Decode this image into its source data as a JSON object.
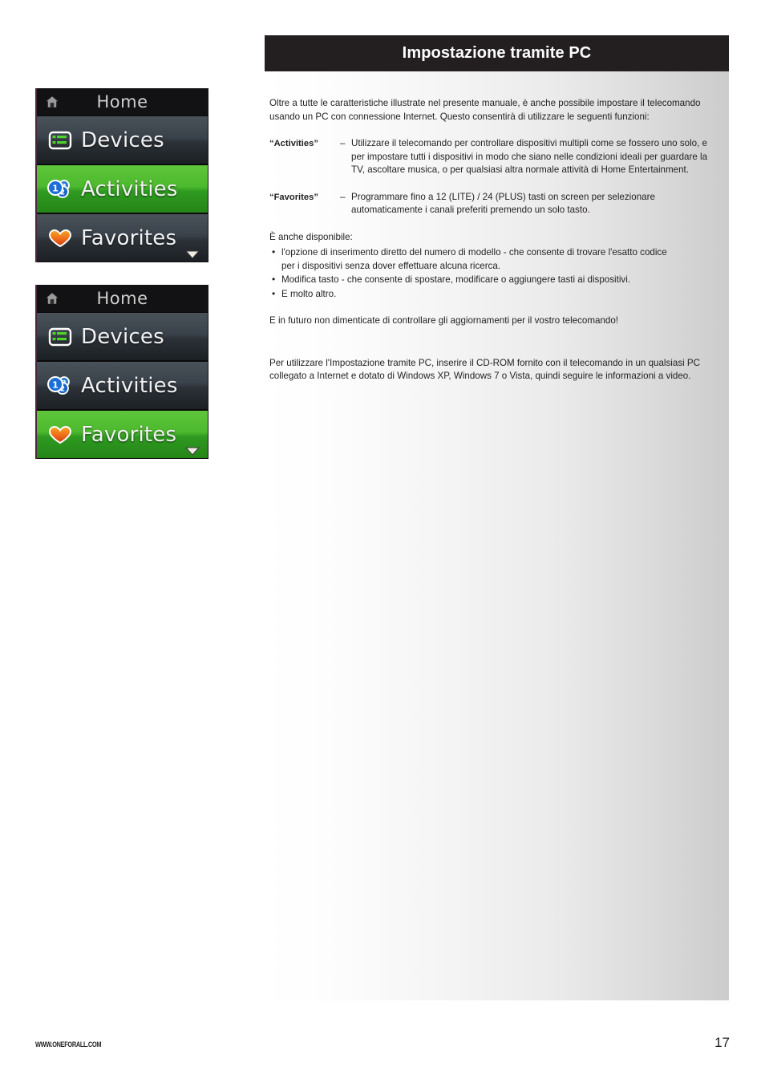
{
  "header": {
    "title": "Impostazione tramite PC"
  },
  "lcd_screens": [
    {
      "titlebar": {
        "icon": "home-icon",
        "label": "Home"
      },
      "rows": [
        {
          "icon": "devices-icon",
          "label": "Devices",
          "highlighted": false
        },
        {
          "icon": "activities-icon",
          "label": "Activities",
          "highlighted": true
        },
        {
          "icon": "favorites-heart-icon",
          "label": "Favorites",
          "highlighted": false
        }
      ],
      "scroll_arrow": "chevron-down-icon"
    },
    {
      "titlebar": {
        "icon": "home-icon",
        "label": "Home"
      },
      "rows": [
        {
          "icon": "devices-icon",
          "label": "Devices",
          "highlighted": false
        },
        {
          "icon": "activities-icon",
          "label": "Activities",
          "highlighted": false
        },
        {
          "icon": "favorites-heart-icon",
          "label": "Favorites",
          "highlighted": true
        }
      ],
      "scroll_arrow": "chevron-down-icon"
    }
  ],
  "body": {
    "intro": "Oltre a tutte le caratteristiche illustrate nel presente manuale, è anche possibile impostare il telecomando usando un PC con connessione Internet. Questo consentirà di utilizzare le seguenti funzioni:",
    "definitions": [
      {
        "term": "“Activities”",
        "dash": "–",
        "line1": "Utilizzare il telecomando per controllare dispositivi multipli come se fossero uno solo, e",
        "line2": "per impostare tutti i dispositivi in modo che siano nelle condizioni ideali per guardare la",
        "line3": "TV, ascoltare musica, o per qualsiasi altra normale attività di Home Entertainment."
      },
      {
        "term": "“Favorites”",
        "dash": "–",
        "line1": "Programmare fino a 12 (LITE) / 24 (PLUS) tasti on screen per selezionare",
        "line2": "automaticamente i canali preferiti premendo un solo tasto.",
        "line3": ""
      }
    ],
    "available_label": "È anche disponibile:",
    "bullets": [
      {
        "line1": "l'opzione di inserimento diretto del numero di modello - che consente di trovare l'esatto codice",
        "line2": "per i dispositivi senza dover effettuare alcuna ricerca."
      },
      {
        "line1": "Modifica tasto - che consente di spostare, modificare o aggiungere tasti ai dispositivi.",
        "line2": ""
      },
      {
        "line1": "E molto altro.",
        "line2": ""
      }
    ],
    "future_note": "E in futuro non dimenticate di controllare gli aggiornamenti per il vostro telecomando!",
    "closing": "Per utilizzare l'Impostazione tramite PC, inserire il CD-ROM fornito con il telecomando in un qualsiasi PC collegato a Internet e dotato di Windows XP, Windows 7 o Vista, quindi seguire le informazioni a video."
  },
  "footer": {
    "url": "WWW.ONEFORALL.COM",
    "page_number": "17"
  },
  "colors": {
    "header_bar": "#231f20",
    "highlight_green": "#4cb92e",
    "lcd_dark": "#39414a",
    "lcd_black": "#121113"
  }
}
